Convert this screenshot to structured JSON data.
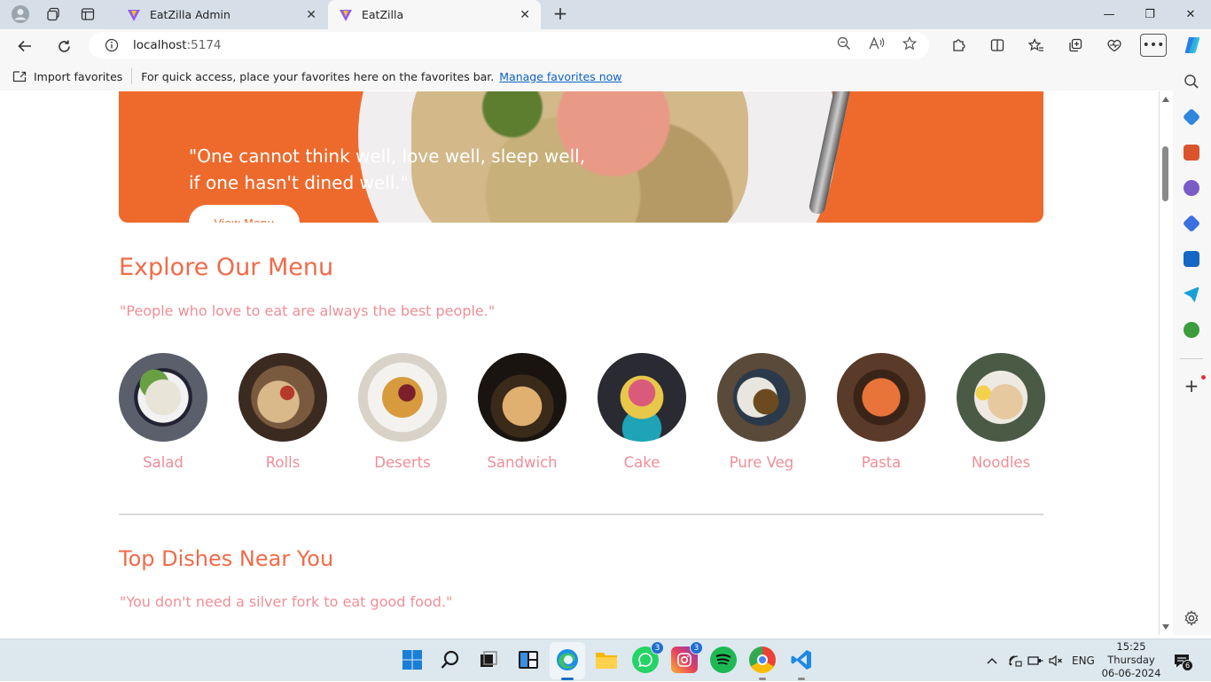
{
  "browser": {
    "tabs": [
      {
        "title": "EatZilla Admin",
        "active": false
      },
      {
        "title": "EatZilla",
        "active": true
      }
    ],
    "url_host": "localhost",
    "url_port": ":5174",
    "favorites_bar": {
      "import_label": "Import favorites",
      "hint": "For quick access, place your favorites here on the favorites bar.",
      "manage_link": "Manage favorites now"
    }
  },
  "page": {
    "hero": {
      "quote_line1": "\"One cannot think well, love well, sleep well,",
      "quote_line2": "if one hasn't dined well.\"",
      "button_label": "View Menu",
      "accent_color": "#ee6a2c"
    },
    "explore": {
      "heading": "Explore Our Menu",
      "quote": "\"People who love to eat are always the best people.\"",
      "items": [
        {
          "label": "Salad"
        },
        {
          "label": "Rolls"
        },
        {
          "label": "Deserts"
        },
        {
          "label": "Sandwich"
        },
        {
          "label": "Cake"
        },
        {
          "label": "Pure Veg"
        },
        {
          "label": "Pasta"
        },
        {
          "label": "Noodles"
        }
      ]
    },
    "top_dishes": {
      "heading": "Top Dishes Near You",
      "quote": "\"You don't need a silver fork to eat good food.\""
    }
  },
  "taskbar": {
    "whatsapp_badge": "3",
    "instagram_badge": "3",
    "notification_count": "6",
    "language": "ENG",
    "time": "15:25",
    "day": "Thursday",
    "date": "06-06-2024"
  }
}
